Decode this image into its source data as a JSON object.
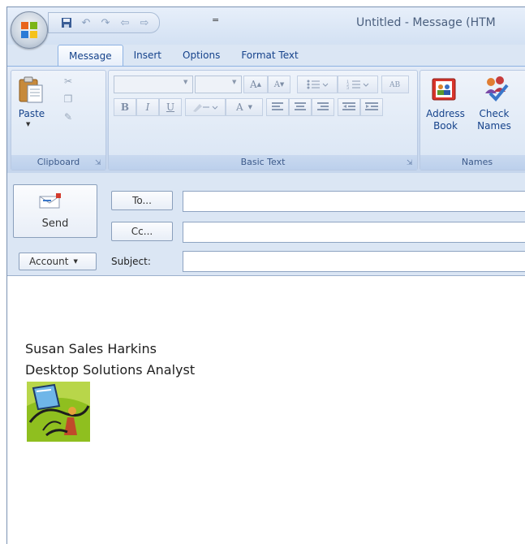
{
  "window": {
    "title": "Untitled - Message (HTM"
  },
  "quick_access": {
    "items": [
      "save-icon",
      "undo-icon",
      "redo-icon",
      "previous-icon",
      "next-icon"
    ],
    "more": "="
  },
  "tabs": [
    {
      "label": "Message"
    },
    {
      "label": "Insert"
    },
    {
      "label": "Options"
    },
    {
      "label": "Format Text"
    }
  ],
  "ribbon": {
    "clipboard": {
      "label": "Clipboard",
      "paste_label": "Paste"
    },
    "basic_text": {
      "label": "Basic Text",
      "bold": "B",
      "italic": "I",
      "underline": "U",
      "grow_font": "A",
      "shrink_font": "A",
      "font_color": "A"
    },
    "names": {
      "label": "Names",
      "address_book_label": "Address Book",
      "address_book_line1": "Address",
      "address_book_line2": "Book",
      "check_names_line1": "Check",
      "check_names_line2": "Names"
    }
  },
  "compose": {
    "send_label": "Send",
    "to_label": "To...",
    "cc_label": "Cc...",
    "account_label": "Account",
    "subject_label": "Subject:",
    "to_value": "",
    "cc_value": "",
    "subject_value": ""
  },
  "body": {
    "signature_name": "Susan Sales Harkins",
    "signature_title": "Desktop Solutions Analyst"
  },
  "colors": {
    "ribbon_bg": "#dbe6f4",
    "label_text": "#15428b",
    "logo_green": "#8fbf1f"
  }
}
